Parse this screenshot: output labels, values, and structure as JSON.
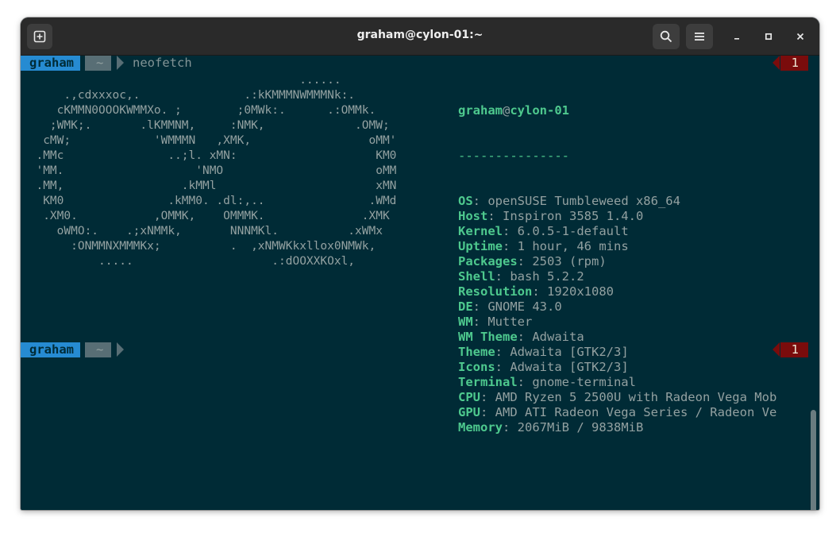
{
  "window": {
    "title": "graham@cylon-01:~"
  },
  "icons": {
    "new_tab": "new-tab-icon",
    "search": "search-icon",
    "menu": "hamburger-menu-icon",
    "minimize": "minimize-icon",
    "maximize": "maximize-icon",
    "close": "close-icon"
  },
  "prompt": {
    "user": "graham",
    "dir": "~",
    "status": "1"
  },
  "command": "neofetch",
  "ascii_art": [
    "                                        ......",
    "      .,cdxxxoc,.               .:kKMMMNWMMMNk:.",
    "     cKMMN0OOOKWMMXo. ;        ;0MWk:.      .:OMMk.",
    "    ;WMK;.       .lKMMNM,     :NMK,             .OMW;",
    "   cMW;            'WMMMN   ,XMK,                 oMM'",
    "  .MMc               ..;l. xMN:                    KM0",
    "  'MM.                   'NMO                      oMM",
    "  .MM,                 .kMMl                       xMN",
    "   KM0               .kMM0. .dl:,..               .WMd",
    "   .XM0.           ,OMMK,    OMMMK.              .XMK",
    "     oWMO:.    .;xNMMk,       NNNMKl.          .xWMx",
    "       :ONMMNXMMMKx;          .  ,xNMWKkxllox0NMWk,",
    "           .....                    .:dOOXXKOxl,"
  ],
  "info": {
    "user": "graham",
    "at": "@",
    "host": "cylon-01",
    "separator": "---------------",
    "rows": [
      {
        "key": "OS",
        "value": "openSUSE Tumbleweed x86_64"
      },
      {
        "key": "Host",
        "value": "Inspiron 3585 1.4.0"
      },
      {
        "key": "Kernel",
        "value": "6.0.5-1-default"
      },
      {
        "key": "Uptime",
        "value": "1 hour, 46 mins"
      },
      {
        "key": "Packages",
        "value": "2503 (rpm)"
      },
      {
        "key": "Shell",
        "value": "bash 5.2.2"
      },
      {
        "key": "Resolution",
        "value": "1920x1080"
      },
      {
        "key": "DE",
        "value": "GNOME 43.0"
      },
      {
        "key": "WM",
        "value": "Mutter"
      },
      {
        "key": "WM Theme",
        "value": "Adwaita"
      },
      {
        "key": "Theme",
        "value": "Adwaita [GTK2/3]"
      },
      {
        "key": "Icons",
        "value": "Adwaita [GTK2/3]"
      },
      {
        "key": "Terminal",
        "value": "gnome-terminal"
      },
      {
        "key": "CPU",
        "value": "AMD Ryzen 5 2500U with Radeon Vega Mob"
      },
      {
        "key": "GPU",
        "value": "AMD ATI Radeon Vega Series / Radeon Ve"
      },
      {
        "key": "Memory",
        "value": "2067MiB / 9838MiB"
      }
    ]
  },
  "colors": {
    "background": "#002b36",
    "user_segment": "#268bd2",
    "dir_segment": "#586e75",
    "status_segment": "#7a0c0c",
    "info_key": "#4ec98e"
  }
}
